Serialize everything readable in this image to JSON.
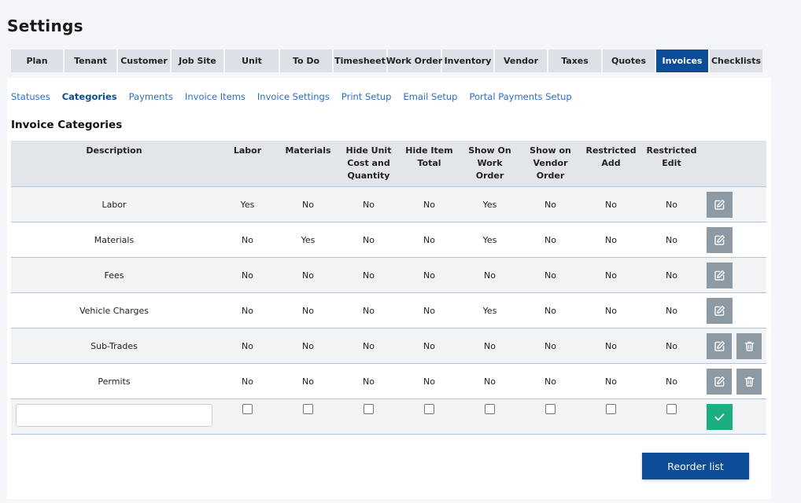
{
  "page": {
    "title": "Settings"
  },
  "main_tabs": [
    {
      "label": "Plan",
      "active": false
    },
    {
      "label": "Tenant",
      "active": false
    },
    {
      "label": "Customer",
      "active": false
    },
    {
      "label": "Job Site",
      "active": false
    },
    {
      "label": "Unit",
      "active": false
    },
    {
      "label": "To Do",
      "active": false
    },
    {
      "label": "Timesheet",
      "active": false
    },
    {
      "label": "Work Order",
      "active": false
    },
    {
      "label": "Inventory",
      "active": false
    },
    {
      "label": "Vendor",
      "active": false
    },
    {
      "label": "Taxes",
      "active": false
    },
    {
      "label": "Quotes",
      "active": false
    },
    {
      "label": "Invoices",
      "active": true
    },
    {
      "label": "Checklists",
      "active": false
    }
  ],
  "sub_tabs": [
    {
      "label": "Statuses",
      "active": false
    },
    {
      "label": "Categories",
      "active": true
    },
    {
      "label": "Payments",
      "active": false
    },
    {
      "label": "Invoice Items",
      "active": false
    },
    {
      "label": "Invoice Settings",
      "active": false
    },
    {
      "label": "Print Setup",
      "active": false
    },
    {
      "label": "Email Setup",
      "active": false
    },
    {
      "label": "Portal Payments Setup",
      "active": false
    }
  ],
  "section": {
    "title": "Invoice Categories"
  },
  "table": {
    "columns": [
      "Description",
      "Labor",
      "Materials",
      "Hide Unit\nCost and\nQuantity",
      "Hide Item\nTotal",
      "Show On\nWork\nOrder",
      "Show on\nVendor\nOrder",
      "Restricted\nAdd",
      "Restricted\nEdit"
    ],
    "rows": [
      {
        "description": "Labor",
        "values": [
          "Yes",
          "No",
          "No",
          "No",
          "Yes",
          "No",
          "No",
          "No"
        ],
        "deletable": false
      },
      {
        "description": "Materials",
        "values": [
          "No",
          "Yes",
          "No",
          "No",
          "Yes",
          "No",
          "No",
          "No"
        ],
        "deletable": false
      },
      {
        "description": "Fees",
        "values": [
          "No",
          "No",
          "No",
          "No",
          "No",
          "No",
          "No",
          "No"
        ],
        "deletable": false
      },
      {
        "description": "Vehicle Charges",
        "values": [
          "No",
          "No",
          "No",
          "No",
          "Yes",
          "No",
          "No",
          "No"
        ],
        "deletable": false
      },
      {
        "description": "Sub-Trades",
        "values": [
          "No",
          "No",
          "No",
          "No",
          "No",
          "No",
          "No",
          "No"
        ],
        "deletable": true
      },
      {
        "description": "Permits",
        "values": [
          "No",
          "No",
          "No",
          "No",
          "No",
          "No",
          "No",
          "No"
        ],
        "deletable": true
      }
    ],
    "new_row": {
      "description_value": "",
      "description_placeholder": "",
      "checks": [
        false,
        false,
        false,
        false,
        false,
        false,
        false,
        false
      ]
    }
  },
  "buttons": {
    "reorder_label": "Reorder list"
  },
  "icons": {
    "edit": "edit-icon",
    "delete": "trash-icon",
    "confirm": "check-icon"
  },
  "colors": {
    "accent": "#0d4c96",
    "link": "#2a6ec3",
    "action_gray": "#8d9aa4",
    "confirm_green": "#1aae82"
  }
}
